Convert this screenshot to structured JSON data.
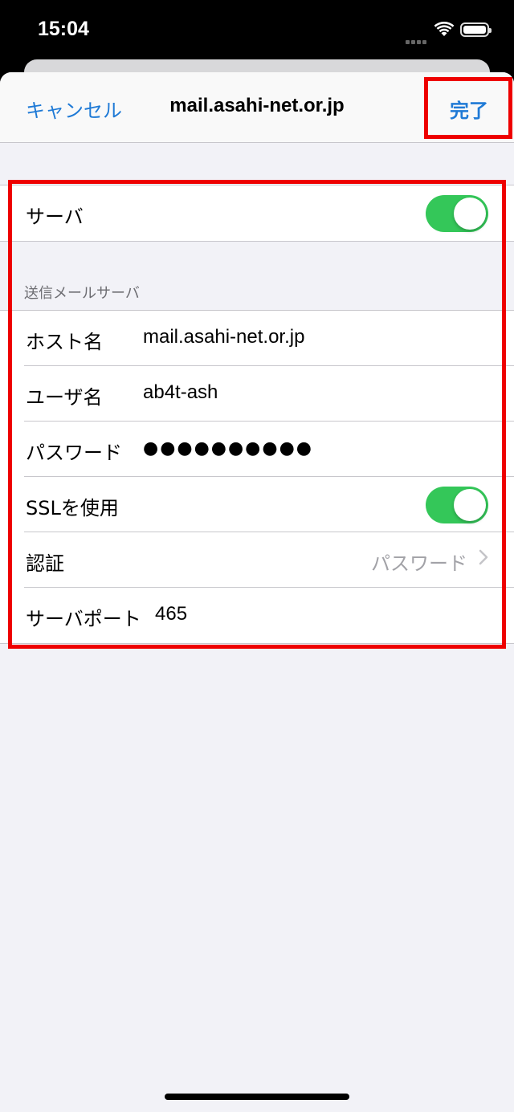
{
  "status": {
    "time": "15:04",
    "icons": [
      "cellular-signal-icon",
      "wifi-icon",
      "battery-icon"
    ]
  },
  "navbar": {
    "cancel": "キャンセル",
    "title": "mail.asahi-net.or.jp",
    "done": "完了"
  },
  "server_row": {
    "label": "サーバ",
    "enabled": true
  },
  "section_header": "送信メールサーバ",
  "fields": {
    "host_label": "ホスト名",
    "host_value": "mail.asahi-net.or.jp",
    "user_label": "ユーザ名",
    "user_value": "ab4t-ash",
    "password_label": "パスワード",
    "password_value": "●●●●●●●●●●",
    "ssl_label": "SSLを使用",
    "ssl_enabled": true,
    "auth_label": "認証",
    "auth_value": "パスワード",
    "port_label": "サーバポート",
    "port_value": "465"
  },
  "colors": {
    "accent": "#1f7ad6",
    "toggle_on": "#34c759",
    "highlight": "#ee0000",
    "background": "#f2f2f7"
  }
}
